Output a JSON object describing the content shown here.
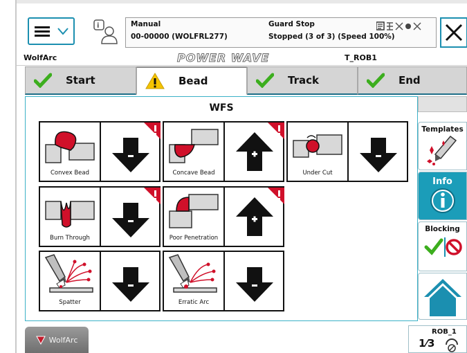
{
  "header": {
    "mode": "Manual",
    "program": "00-00000 (WOLFRL277)",
    "safety_state": "Guard Stop",
    "run_state": "Stopped (3 of 3) (Speed 100%)"
  },
  "titlebar": {
    "app_name": "WolfArc",
    "logo": "POWER WAVE",
    "robot": "T_ROB1"
  },
  "tabs": [
    {
      "label": "Start",
      "status": "ok"
    },
    {
      "label": "Bead",
      "status": "warning"
    },
    {
      "label": "Track",
      "status": "ok"
    },
    {
      "label": "End",
      "status": "ok"
    }
  ],
  "panel": {
    "title": "WFS",
    "defects": [
      {
        "label": "Convex Bead",
        "adjust": "decrease",
        "flagged": true
      },
      {
        "label": "Concave Bead",
        "adjust": "increase",
        "flagged": true
      },
      {
        "label": "Under Cut",
        "adjust": "decrease",
        "flagged": false
      },
      {
        "label": "Burn Through",
        "adjust": "decrease",
        "flagged": true
      },
      {
        "label": "Poor Penetration",
        "adjust": "increase",
        "flagged": true
      },
      {
        "label": "Spatter",
        "adjust": "decrease",
        "flagged": false
      },
      {
        "label": "Erratic Arc",
        "adjust": "decrease",
        "flagged": false
      }
    ]
  },
  "sidebar": {
    "templates": "Templates",
    "info": "Info",
    "blocking": "Blocking",
    "home_icon": "home-icon"
  },
  "footer": {
    "wolfarc_button": "WolfArc",
    "robot": "ROB_1",
    "fraction": "1⁄3"
  },
  "colors": {
    "accent": "#1b8fb0",
    "check": "#3cae1e",
    "warning": "#f5c400",
    "flag": "#d0102a",
    "info": "#1b9db9"
  }
}
